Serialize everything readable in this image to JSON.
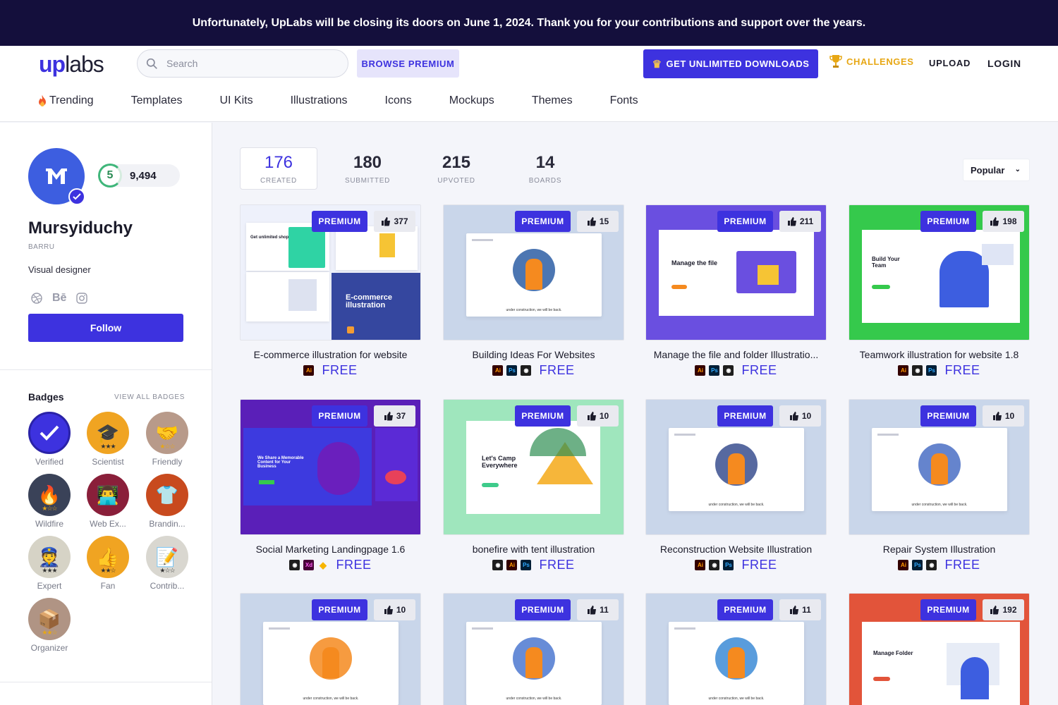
{
  "announcement": "Unfortunately, UpLabs will be closing its doors on June 1, 2024. Thank you for your contributions and support over the years.",
  "header": {
    "logo_up": "up",
    "logo_labs": "labs",
    "search_placeholder": "Search",
    "browse_premium": "BROWSE PREMIUM",
    "unlimited": "GET UNLIMITED DOWNLOADS",
    "challenges": "CHALLENGES",
    "upload": "UPLOAD",
    "login": "LOGIN"
  },
  "nav": [
    "Trending",
    "Templates",
    "UI Kits",
    "Illustrations",
    "Icons",
    "Mockups",
    "Themes",
    "Fonts"
  ],
  "profile": {
    "level": "5",
    "score": "9,494",
    "name": "Mursyiduchy",
    "handle": "BARRU",
    "bio": "Visual designer",
    "follow": "Follow",
    "social_behance": "Bē"
  },
  "badges": {
    "title": "Badges",
    "view_all": "VIEW ALL BADGES",
    "items": [
      {
        "label": "Verified",
        "icon": "check-icon",
        "color": "#3d32df"
      },
      {
        "label": "Scientist",
        "icon": "graduation-cap-icon",
        "color": "#f0a422"
      },
      {
        "label": "Friendly",
        "icon": "handshake-icon",
        "color": "#b89a8a"
      },
      {
        "label": "Wildfire",
        "icon": "fire-icon",
        "color": "#3a4258"
      },
      {
        "label": "Web Ex...",
        "icon": "laptop-user-icon",
        "color": "#8a1f3a"
      },
      {
        "label": "Brandin...",
        "icon": "shirt-icon",
        "color": "#c84a1e"
      },
      {
        "label": "Expert",
        "icon": "officer-icon",
        "color": "#d6d3c6"
      },
      {
        "label": "Fan",
        "icon": "thumbs-up-icon",
        "color": "#f0a422"
      },
      {
        "label": "Contrib...",
        "icon": "notepad-icon",
        "color": "#d9d7d0"
      },
      {
        "label": "Organizer",
        "icon": "box-icon",
        "color": "#b09484"
      }
    ]
  },
  "stats": [
    {
      "num": "176",
      "label": "CREATED"
    },
    {
      "num": "180",
      "label": "SUBMITTED"
    },
    {
      "num": "215",
      "label": "UPVOTED"
    },
    {
      "num": "14",
      "label": "BOARDS"
    }
  ],
  "sort": "Popular",
  "premium_label": "PREMIUM",
  "free_label": "FREE",
  "cards": [
    {
      "title": "E-commerce illustration for website",
      "likes": "377",
      "tools": [
        "ai"
      ],
      "bg": "#eef1fb"
    },
    {
      "title": "Building Ideas For Websites",
      "likes": "15",
      "tools": [
        "ai",
        "ps",
        "figma"
      ],
      "bg": "#c9d6ea"
    },
    {
      "title": "Manage the file and folder Illustratio...",
      "likes": "211",
      "tools": [
        "ai",
        "ps",
        "figma"
      ],
      "bg": "#6a4fe0"
    },
    {
      "title": "Teamwork illustration for website 1.8",
      "likes": "198",
      "tools": [
        "ai",
        "figma",
        "ps"
      ],
      "bg": "#35c94c"
    },
    {
      "title": "Social Marketing Landingpage 1.6",
      "likes": "37",
      "tools": [
        "figma",
        "xd",
        "sketch"
      ],
      "bg": "#5a1fb8"
    },
    {
      "title": "bonefire with tent illustration",
      "likes": "10",
      "tools": [
        "figma",
        "ai",
        "ps"
      ],
      "bg": "#9fe6bd"
    },
    {
      "title": "Reconstruction Website Illustration",
      "likes": "10",
      "tools": [
        "ai",
        "figma",
        "ps"
      ],
      "bg": "#c9d6ea"
    },
    {
      "title": "Repair System Illustration",
      "likes": "10",
      "tools": [
        "ai",
        "ps",
        "figma"
      ],
      "bg": "#c9d6ea"
    },
    {
      "title": "",
      "likes": "10",
      "tools": [],
      "bg": "#c9d6ea"
    },
    {
      "title": "",
      "likes": "11",
      "tools": [],
      "bg": "#c9d6ea"
    },
    {
      "title": "",
      "likes": "11",
      "tools": [],
      "bg": "#c9d6ea"
    },
    {
      "title": "",
      "likes": "192",
      "tools": [],
      "bg": "#e2543a"
    }
  ],
  "thumb_text": {
    "ecom": "E-commerce illustration",
    "ecom_small": "Get unlimited shop",
    "manage_file": "Manage the file",
    "build_team": "Build Your Team",
    "share_content": "We Share a Memorable Content for Your Business",
    "camp": "Let's Camp Everywhere",
    "manage_folder": "Manage Folder",
    "under_construction": "under construction, we will be back."
  }
}
